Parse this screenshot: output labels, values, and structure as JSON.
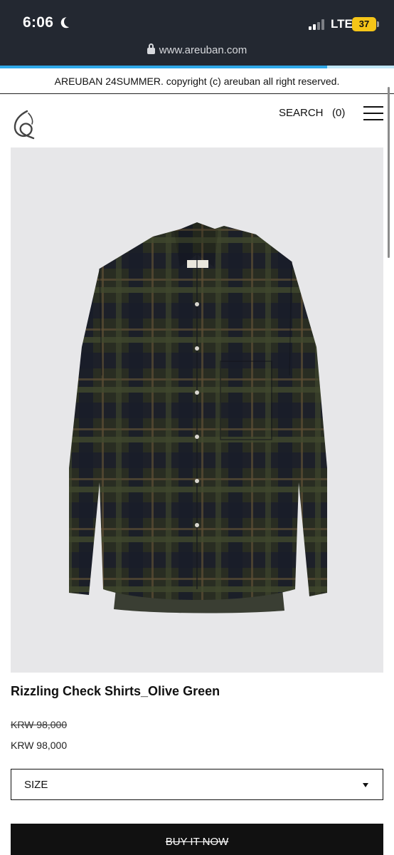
{
  "status_bar": {
    "time": "6:06",
    "network": "LTE",
    "battery": "37"
  },
  "browser": {
    "url": "www.areuban.com",
    "load_progress": 0.83
  },
  "notice": {
    "text": "AREUBAN 24SUMMER. copyright (c) areuban all right reserved."
  },
  "header": {
    "search_label": "SEARCH",
    "cart_count": "(0)"
  },
  "product": {
    "name": "Rizzling Check Shirts_Olive Green",
    "price_original": "KRW 98,000",
    "price_sale": "KRW 98,000",
    "size_label": "SIZE",
    "buy_label": "BUY IT NOW"
  },
  "icons": {
    "logo": "areuban-logo-icon",
    "menu": "hamburger-menu-icon",
    "lock": "lock-icon",
    "moon": "moon-icon",
    "size_caret": "caret-down-icon"
  },
  "colors": {
    "accent_progress": "#2fa8e8",
    "battery": "#f5c518",
    "button": "#111111"
  }
}
